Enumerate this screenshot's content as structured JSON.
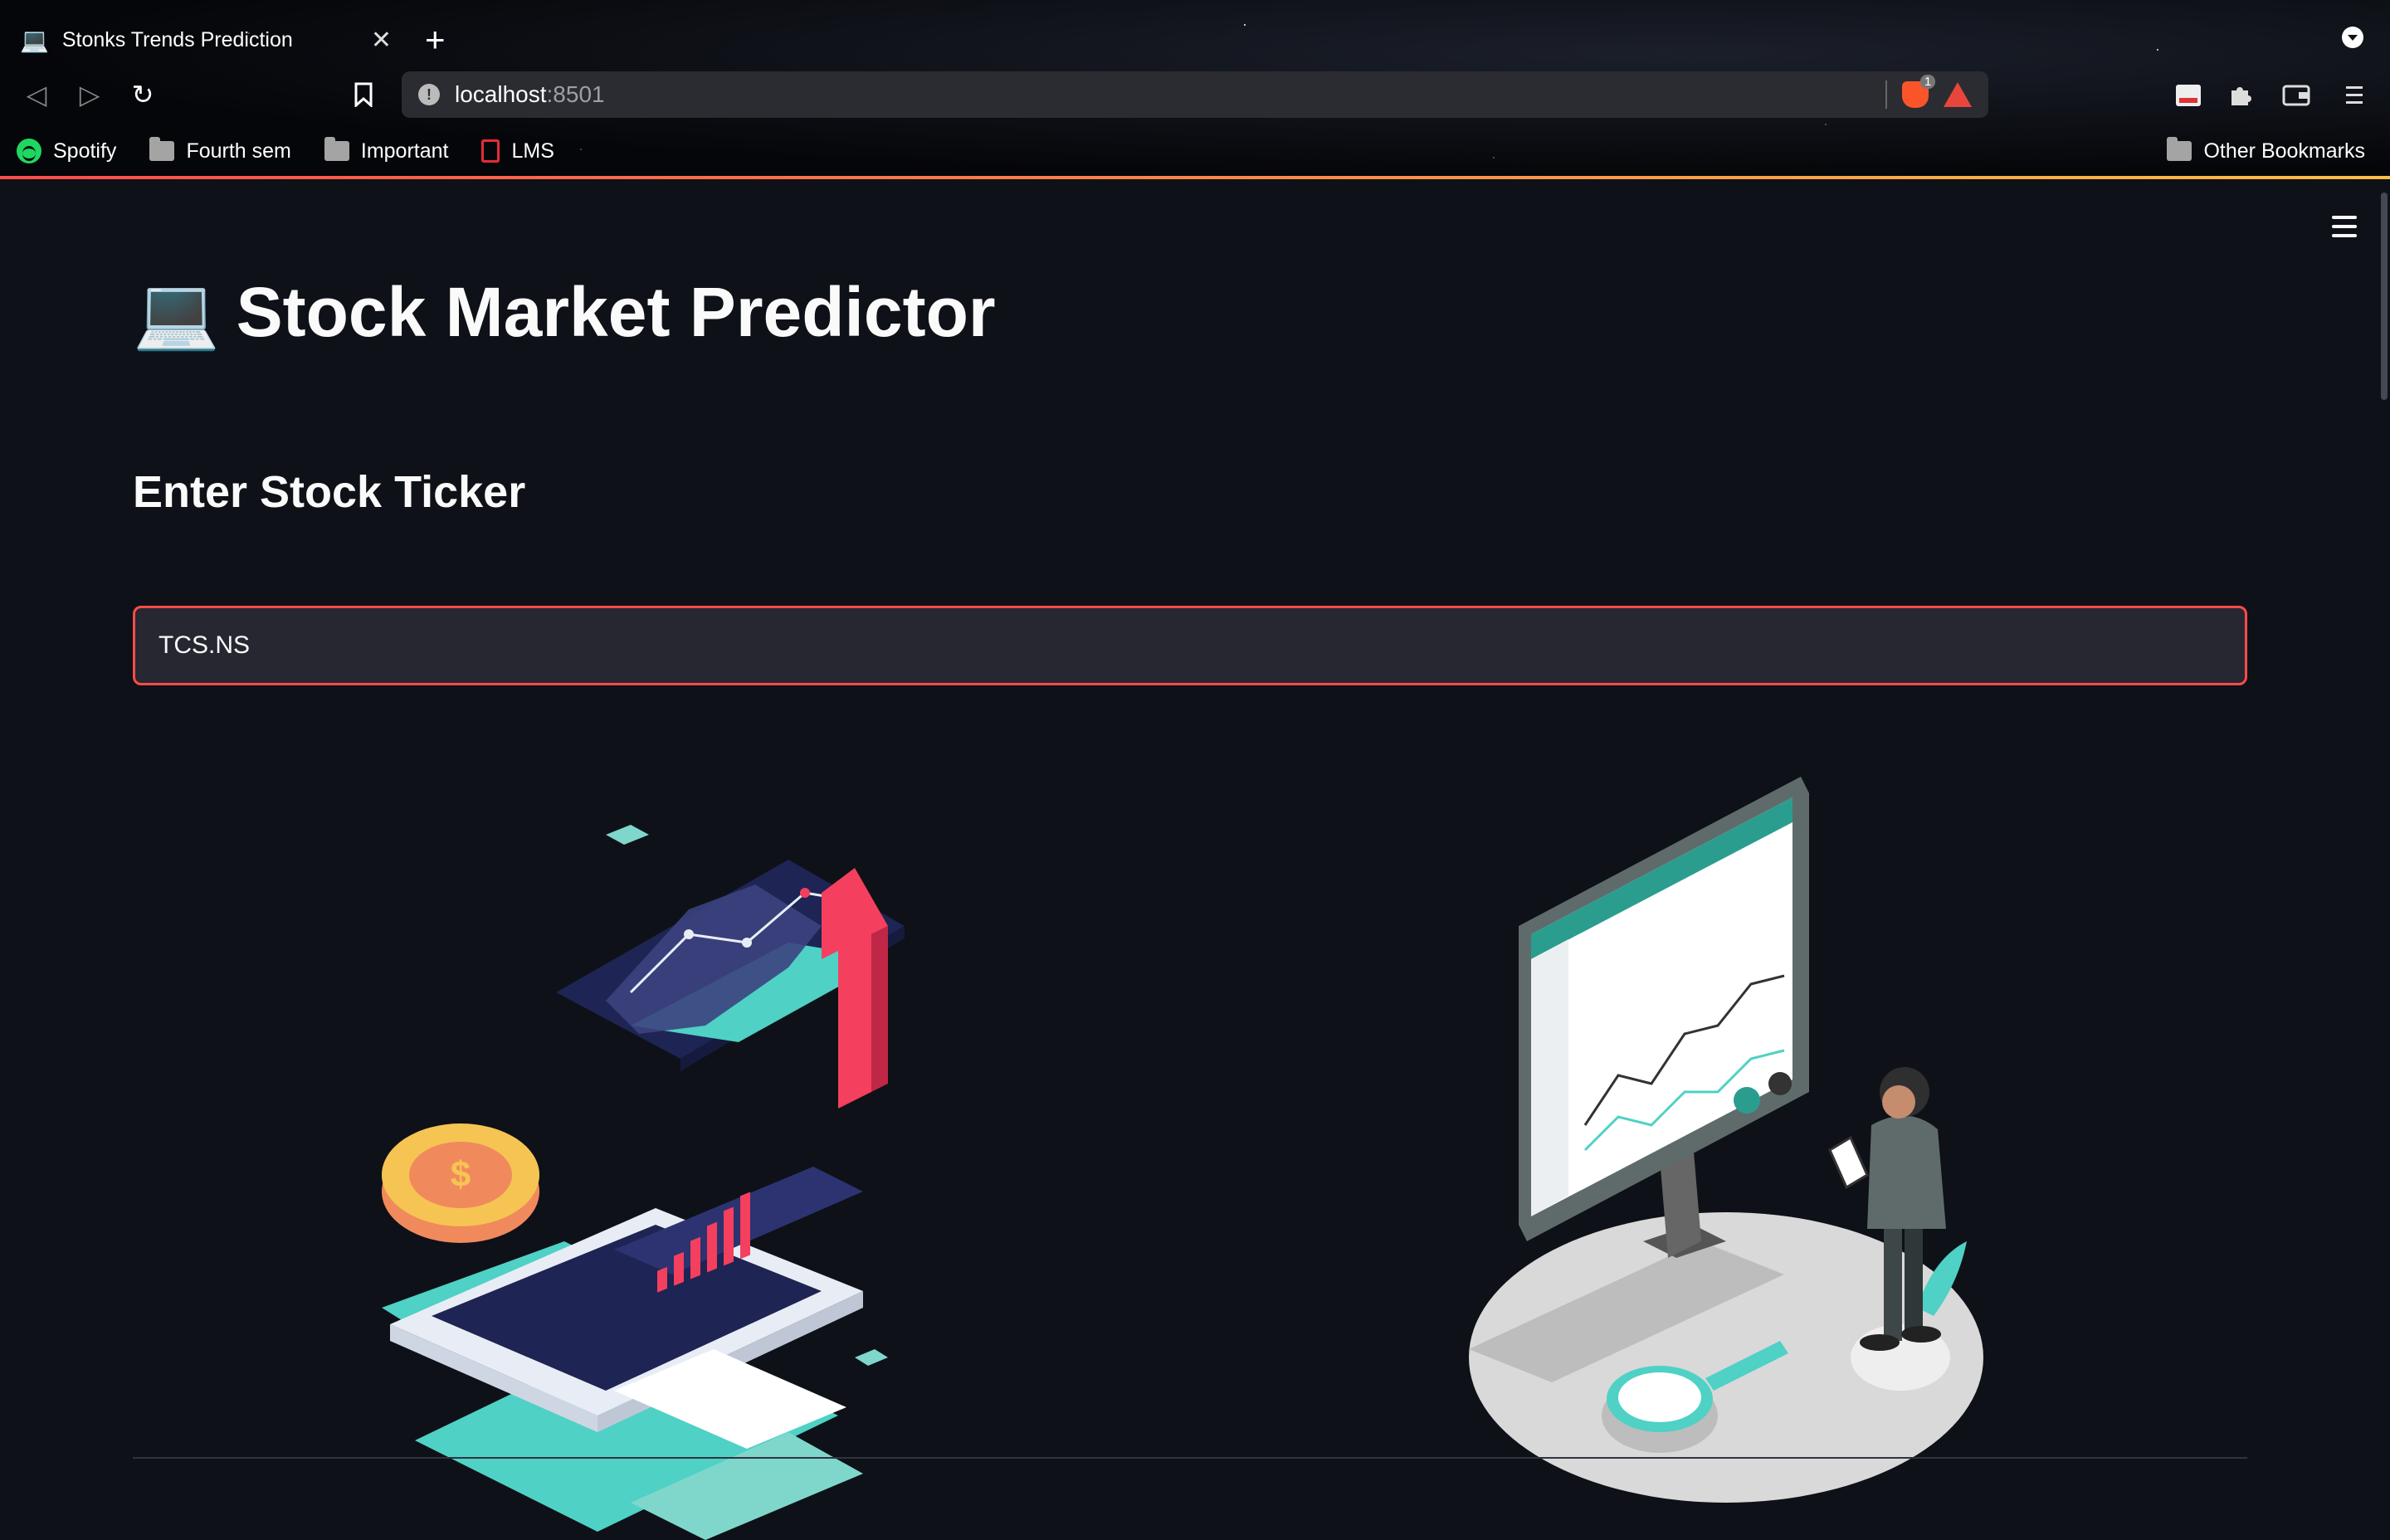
{
  "browser": {
    "tab": {
      "favicon": "💻",
      "title": "Stonks Trends Prediction"
    },
    "new_tab_icon": "+",
    "url": {
      "host": "localhost",
      "port": ":8501"
    },
    "brave_shields_count": "1",
    "bookmarks": [
      {
        "label": "Spotify",
        "icon": "spotify-icon"
      },
      {
        "label": "Fourth sem",
        "icon": "folder-icon"
      },
      {
        "label": "Important",
        "icon": "folder-icon"
      },
      {
        "label": "LMS",
        "icon": "lms-icon"
      }
    ],
    "other_bookmarks": "Other Bookmarks"
  },
  "app": {
    "title_emoji": "💻",
    "title": "Stock Market Predictor",
    "subheader": "Enter Stock Ticker",
    "ticker_input": {
      "value": "TCS.NS"
    },
    "colors": {
      "accent": "#ff4b4b",
      "background": "#0e1117",
      "input_bg": "#262730",
      "teal": "#4fd1c5",
      "navy": "#1e2453",
      "pink": "#f43f5e"
    }
  }
}
